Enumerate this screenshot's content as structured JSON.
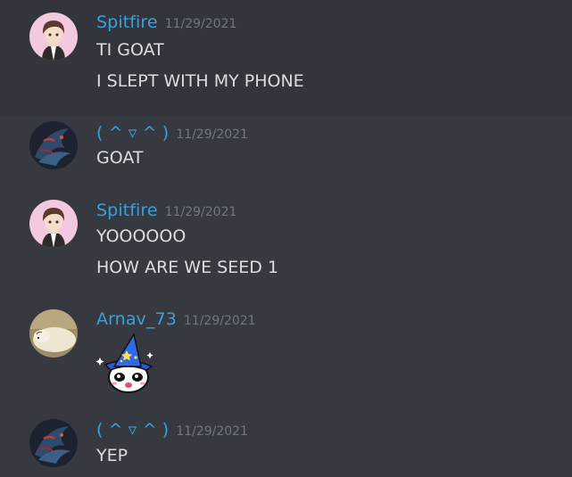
{
  "messages": [
    {
      "author": "Spitfire",
      "timestamp": "11/29/2021",
      "lines": [
        "TI GOAT",
        "I SLEPT WITH MY PHONE"
      ],
      "avatar": "anime-boy-avatar"
    },
    {
      "author": "( ^ ▿ ^ )",
      "timestamp": "11/29/2021",
      "lines": [
        "GOAT"
      ],
      "avatar": "dark-dragon-avatar"
    },
    {
      "author": "Spitfire",
      "timestamp": "11/29/2021",
      "lines": [
        "YOOOOOO",
        "HOW ARE WE SEED 1"
      ],
      "avatar": "anime-boy-avatar"
    },
    {
      "author": "Arnav_73",
      "timestamp": "11/29/2021",
      "lines": [],
      "emoji": "wizard-panda-emoji",
      "avatar": "sleeping-dog-avatar"
    },
    {
      "author": "( ^ ▿ ^ )",
      "timestamp": "11/29/2021",
      "lines": [
        "YEP"
      ],
      "avatar": "dark-dragon-avatar"
    }
  ],
  "colors": {
    "background": "#36393f",
    "hover_background": "#32353b",
    "username": "#3ba1dd",
    "timestamp": "#72767d",
    "text": "#dcddde"
  }
}
